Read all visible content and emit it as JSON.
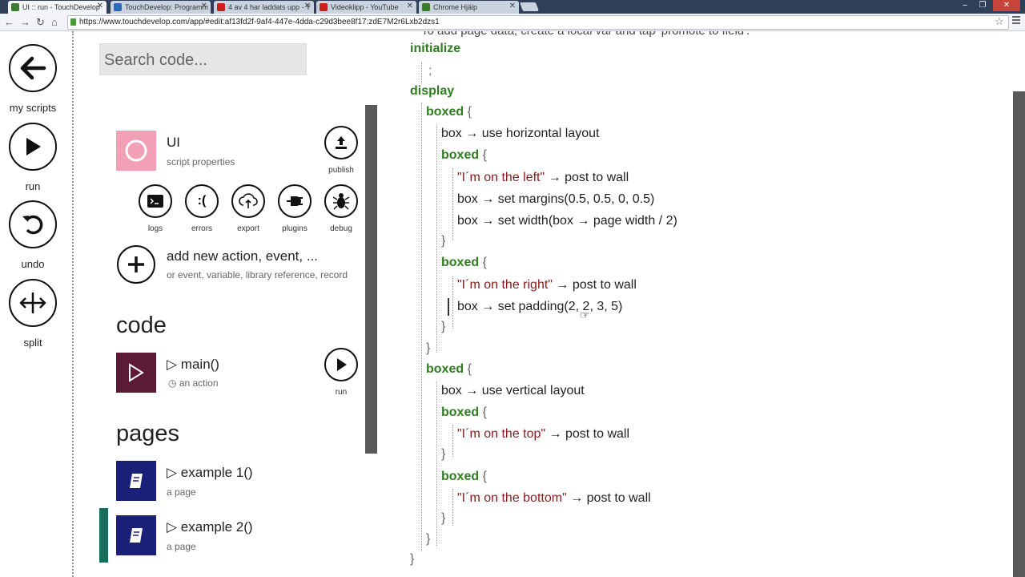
{
  "browser": {
    "tabs": [
      {
        "label": "UI :: run - TouchDevelop",
        "favicon_color": "#3a7d2c"
      },
      {
        "label": "TouchDevelop: Programm",
        "favicon_color": "#2c6bb5"
      },
      {
        "label": "4 av 4 har laddats upp - Y",
        "favicon_color": "#cc1f1f"
      },
      {
        "label": "Videoklipp - YouTube",
        "favicon_color": "#cc1f1f"
      },
      {
        "label": "Chrome Hjälp",
        "favicon_color": "#3a7d2c"
      }
    ],
    "url": "https://www.touchdevelop.com/app/#edit:af13fd2f-9af4-447e-4dda-c29d3bee8f17:zdE7M2r6Lxb2dzs1",
    "window_buttons": {
      "minimize": "–",
      "restore": "❐",
      "close": "✕"
    }
  },
  "nav": [
    {
      "label": "my scripts",
      "icon": "back-arrow-icon"
    },
    {
      "label": "run",
      "icon": "play-icon"
    },
    {
      "label": "undo",
      "icon": "undo-icon"
    },
    {
      "label": "split",
      "icon": "split-icon"
    }
  ],
  "panel": {
    "search_placeholder": "Search code...",
    "script": {
      "title": "UI",
      "subtitle": "script properties",
      "tile_color": "#f2a0b6"
    },
    "publish_label": "publish",
    "tools": [
      "logs",
      "errors",
      "export",
      "plugins",
      "debug"
    ],
    "add": {
      "title": "add new action, event, ...",
      "subtitle": "or event, variable, library reference, record"
    },
    "code_heading": "code",
    "main_action": {
      "title": "▷ main()",
      "subtitle": "an action",
      "run_label": "run"
    },
    "pages_heading": "pages",
    "pages": [
      {
        "title": "▷ example 1()",
        "subtitle": "a page"
      },
      {
        "title": "▷ example 2()",
        "subtitle": "a page"
      }
    ]
  },
  "code": {
    "top_hint": "To add page data, create a local var and tap 'promote to field'.",
    "initialize": "initialize",
    "semicolon": ";",
    "display": "display",
    "boxed": "boxed",
    "brace_open": "{",
    "brace_close": "}",
    "box1_layout": "box → use horizontal layout",
    "left_str": "\"I´m on the left\"",
    "post_to_wall": "→ post to wall",
    "left_margins": "box → set margins(0.5, 0.5, 0, 0.5)",
    "left_width": "box → set width(box → page width / 2)",
    "right_str": "\"I´m on the right\"",
    "right_padding": "box → set padding(2, 2, 3, 5)",
    "box2_layout": "box → use vertical layout",
    "top_str": "\"I´m on the top\"",
    "bottom_str": "\"I´m on the bottom\""
  }
}
